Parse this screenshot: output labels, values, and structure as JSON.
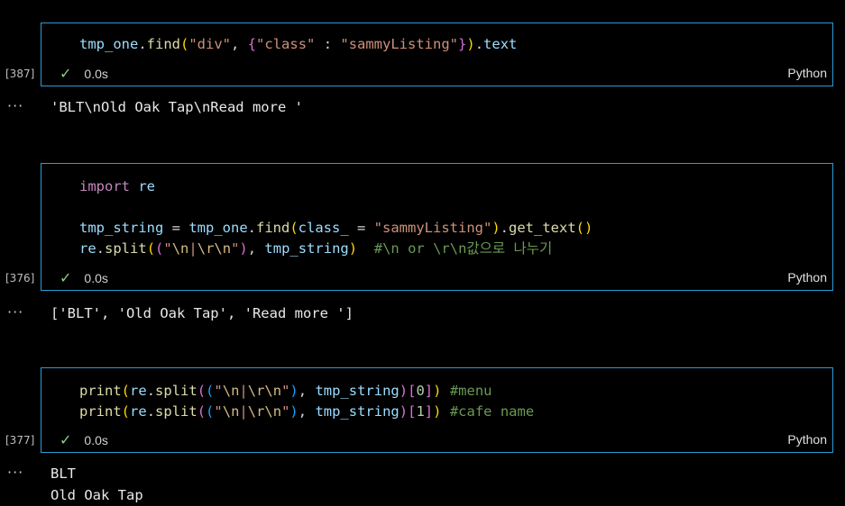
{
  "cells": [
    {
      "exec_count": "[387]",
      "lines": [
        "tmp_one.find(\"div\", {\"class\" : \"sammyListing\"}).text"
      ],
      "time": "0.0s",
      "language": "Python",
      "output": "'BLT\\nOld Oak Tap\\nRead more '"
    },
    {
      "exec_count": "[376]",
      "lines": [
        "import re",
        "",
        "tmp_string = tmp_one.find(class_ = \"sammyListing\").get_text()",
        "re.split((\"\\n|\\r\\n\"), tmp_string)  #\\n or \\r\\n값으로 나누기"
      ],
      "time": "0.0s",
      "language": "Python",
      "output": "['BLT', 'Old Oak Tap', 'Read more ']"
    },
    {
      "exec_count": "[377]",
      "lines": [
        "print(re.split((\"\\n|\\r\\n\"), tmp_string)[0]) #menu",
        "print(re.split((\"\\n|\\r\\n\"), tmp_string)[1]) #cafe name"
      ],
      "time": "0.0s",
      "language": "Python",
      "output_lines": [
        "BLT",
        "Old Oak Tap"
      ]
    }
  ],
  "icons": {
    "check": "check-icon",
    "more": "ellipsis-icon"
  },
  "colors": {
    "cell_border": "#2a9dd6",
    "success": "#89d185"
  }
}
